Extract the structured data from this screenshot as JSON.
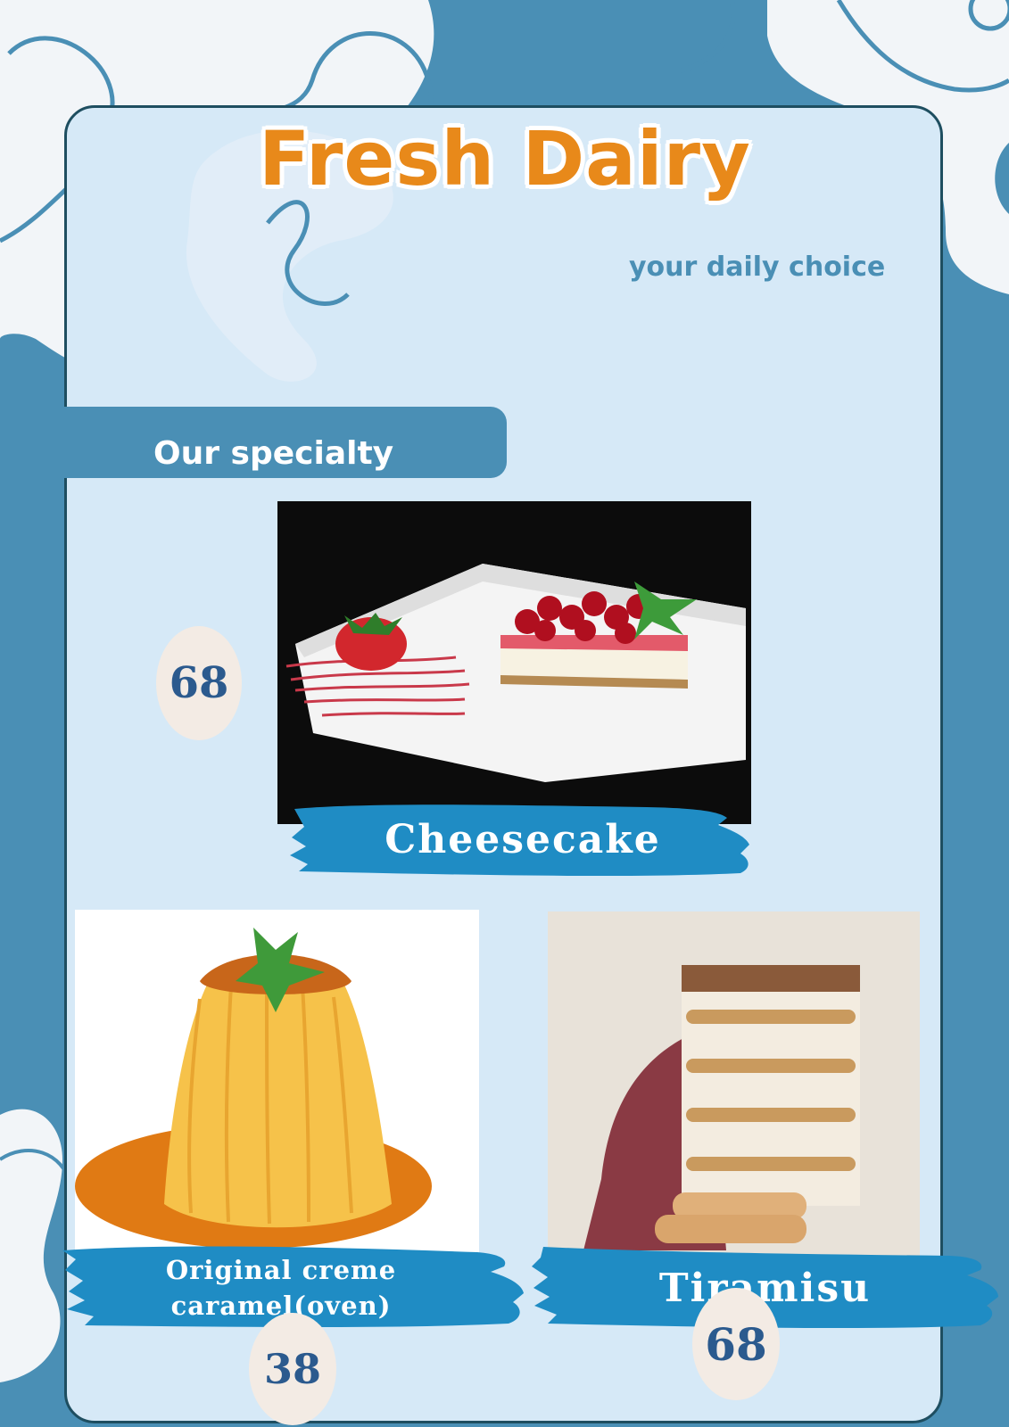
{
  "header": {
    "title": "Fresh Dairy",
    "subtitle": "your daily choice"
  },
  "section": {
    "label": "Our specialty"
  },
  "items": [
    {
      "name": "Cheesecake",
      "price": "68"
    },
    {
      "name": "Original creme caramel(oven)",
      "price": "38"
    },
    {
      "name": "Tiramisu",
      "price": "68"
    }
  ],
  "colors": {
    "background": "#4a8fb5",
    "panel": "#d6e9f7",
    "title": "#e8891a",
    "brush": "#1f8cc4",
    "price_text": "#2b5a8e",
    "price_badge": "#f3ebe4"
  }
}
